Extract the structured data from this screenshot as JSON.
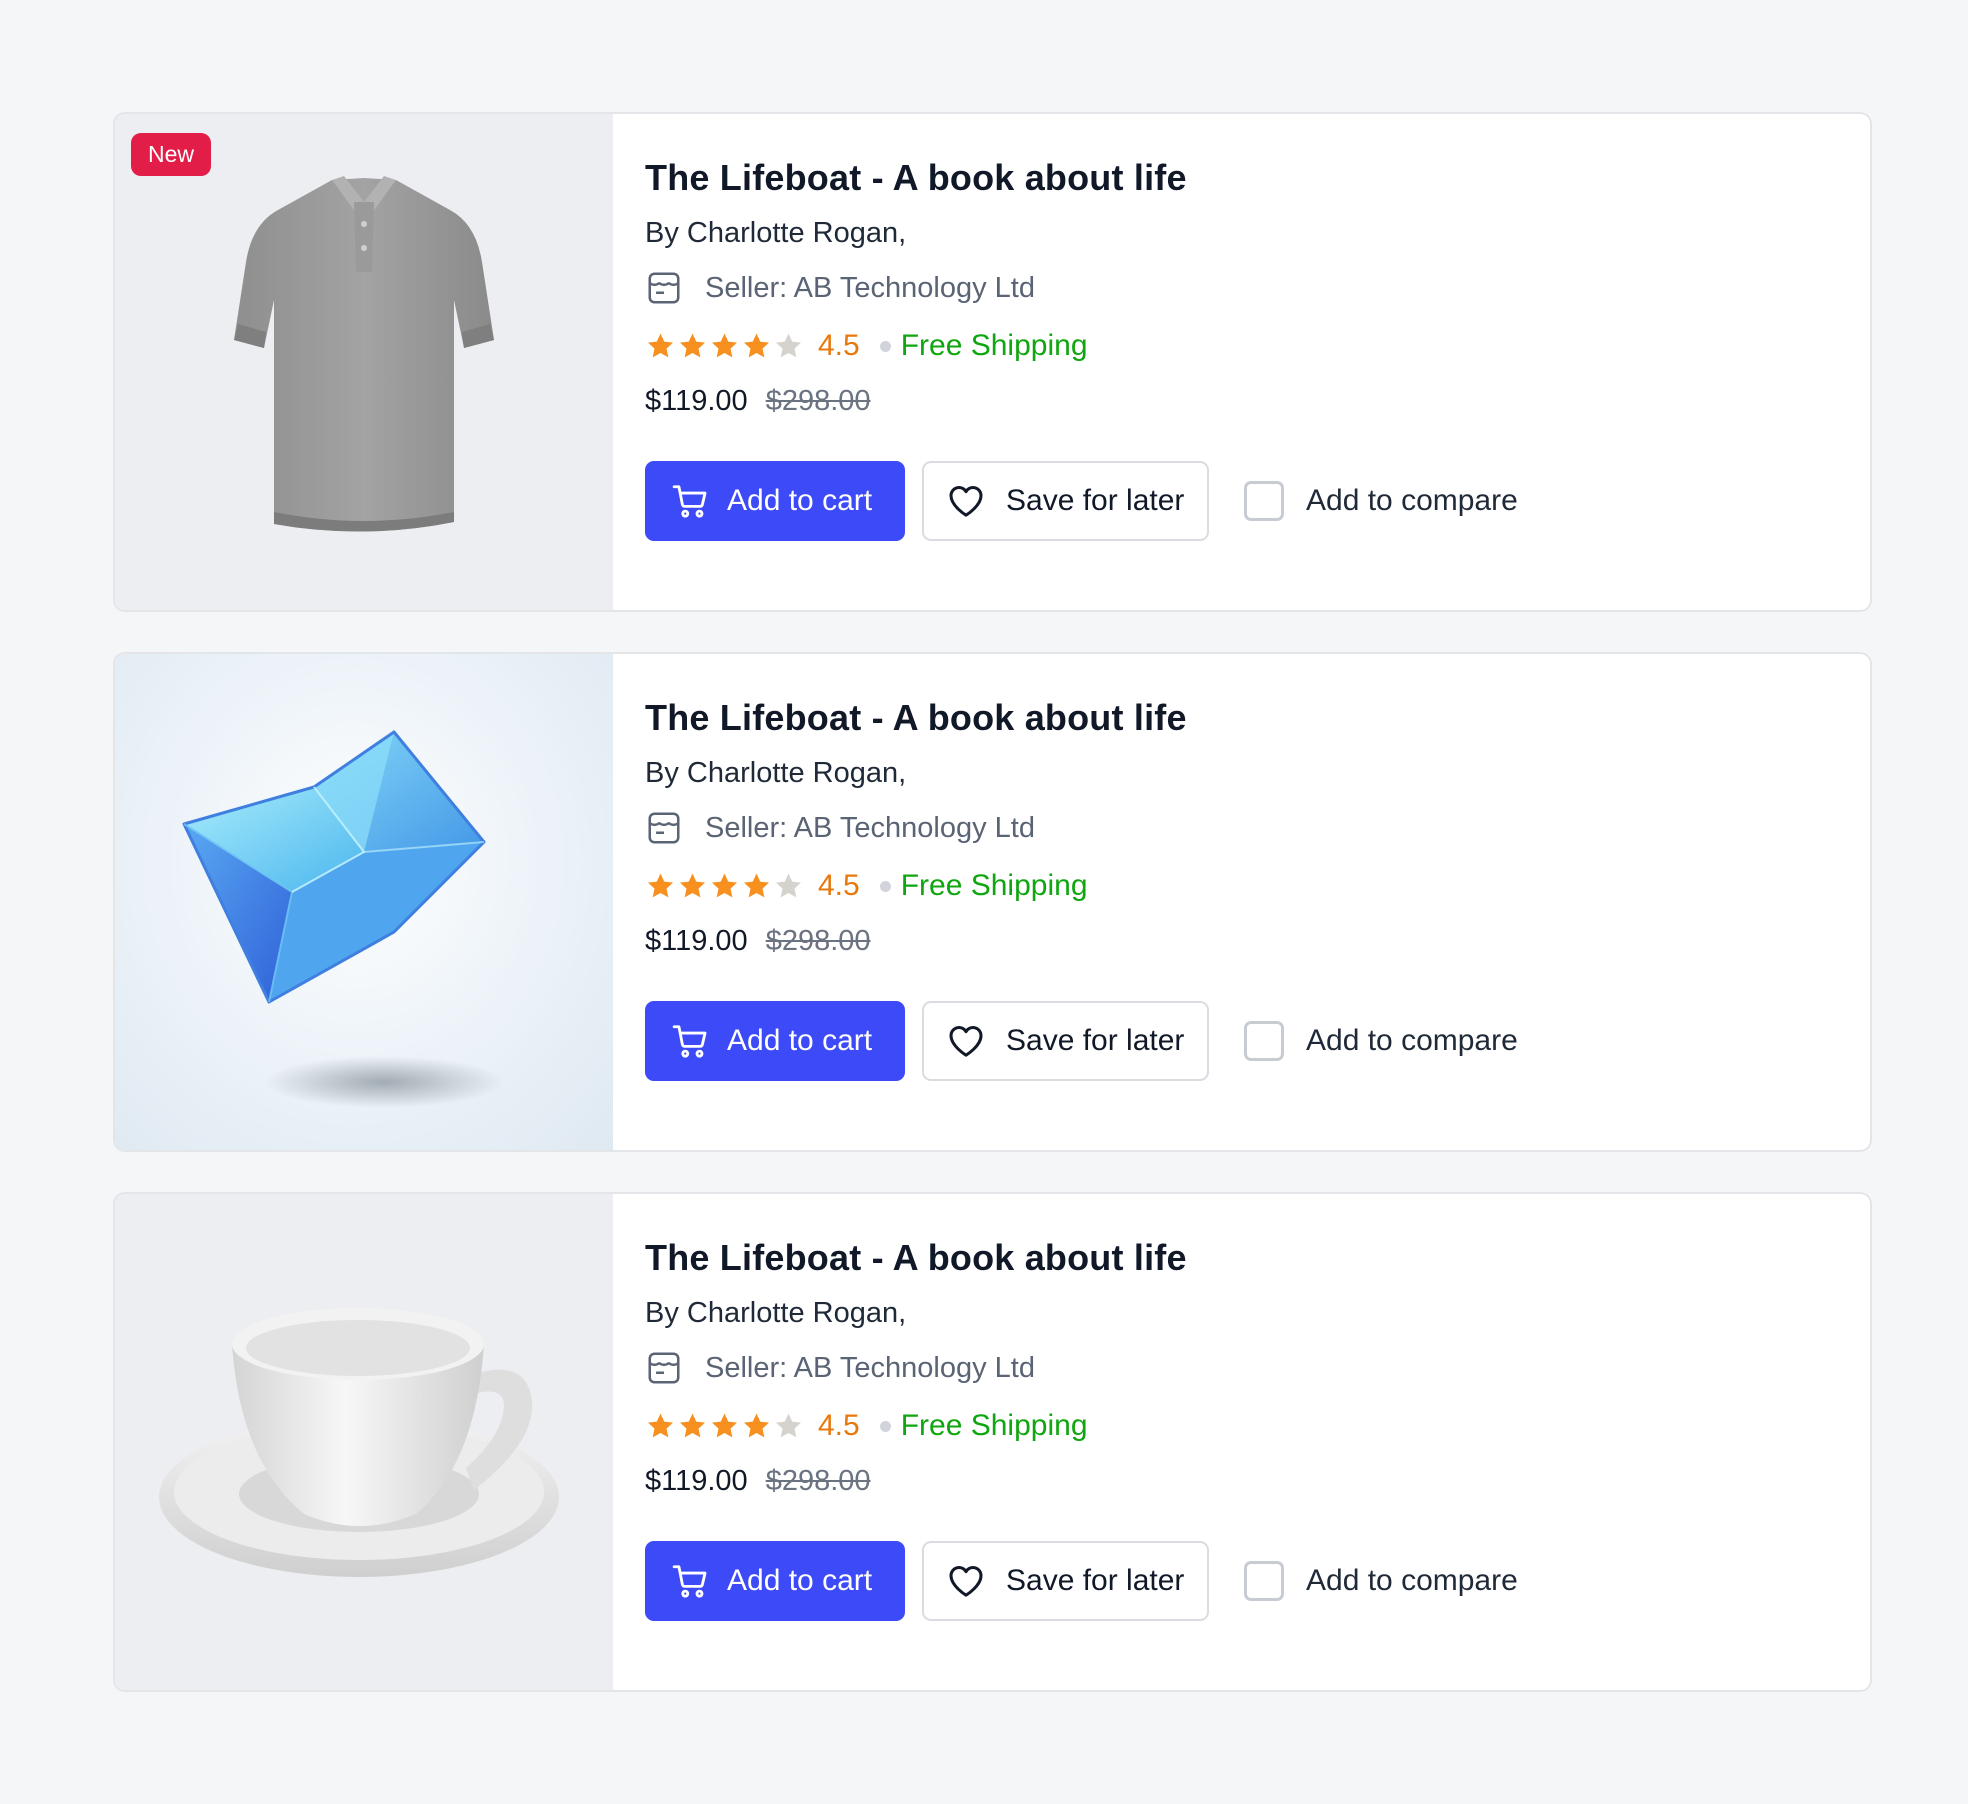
{
  "products": [
    {
      "badge": "New",
      "image_icon": "polo-shirt-image",
      "title": "The Lifeboat - A book about life",
      "author": "By Charlotte Rogan,",
      "seller": "Seller: AB Technology Ltd",
      "rating": "4.5",
      "stars": 4,
      "shipping": "Free Shipping",
      "price": "$119.00",
      "old_price": "$298.00",
      "add_to_cart": "Add to cart",
      "save_for_later": "Save for later",
      "compare": "Add to compare"
    },
    {
      "badge": "",
      "image_icon": "blue-cube-image",
      "title": "The Lifeboat - A book about life",
      "author": "By Charlotte Rogan,",
      "seller": "Seller: AB Technology Ltd",
      "rating": "4.5",
      "stars": 4,
      "shipping": "Free Shipping",
      "price": "$119.00",
      "old_price": "$298.00",
      "add_to_cart": "Add to cart",
      "save_for_later": "Save for later",
      "compare": "Add to compare"
    },
    {
      "badge": "",
      "image_icon": "teacup-image",
      "title": "The Lifeboat - A book about life",
      "author": "By Charlotte Rogan,",
      "seller": "Seller: AB Technology Ltd",
      "rating": "4.5",
      "stars": 4,
      "shipping": "Free Shipping",
      "price": "$119.00",
      "old_price": "$298.00",
      "add_to_cart": "Add to cart",
      "save_for_later": "Save for later",
      "compare": "Add to compare"
    }
  ],
  "colors": {
    "primary": "#3d4af7",
    "badge": "#e11d48",
    "star": "#f7901e",
    "star_empty": "#d6d3cf",
    "rating": "#e8780c",
    "shipping": "#0fa60f"
  }
}
